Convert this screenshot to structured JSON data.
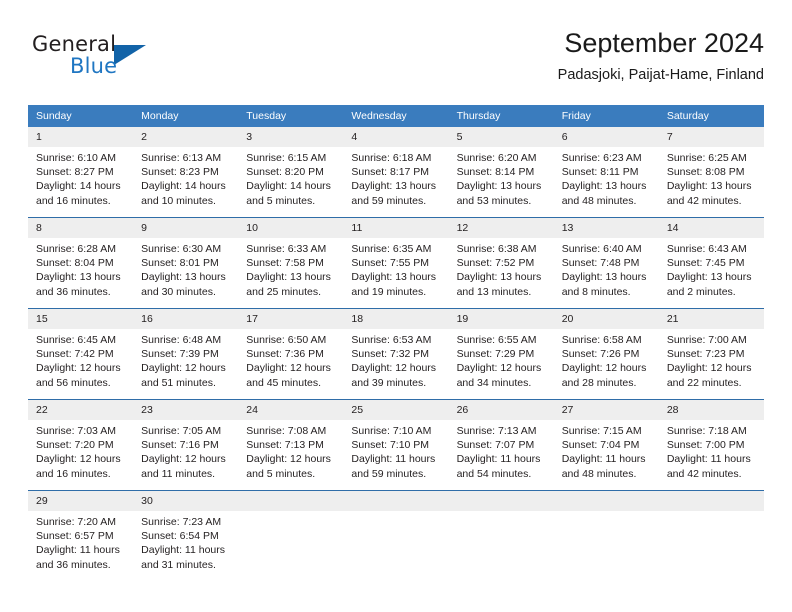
{
  "logo": {
    "word1": "General",
    "word2": "Blue",
    "triangle_color": "#1263a8",
    "text_color": "#231f20",
    "blue_color": "#1f76c2"
  },
  "header": {
    "title": "September 2024",
    "subtitle": "Padasjoki, Paijat-Hame, Finland"
  },
  "theme": {
    "header_bg": "#3a7cbe",
    "header_text": "#ffffff",
    "daynum_bg": "#eeeeee",
    "grid_line": "#2f6da8",
    "body_text": "#231f20"
  },
  "weekday_headers": [
    "Sunday",
    "Monday",
    "Tuesday",
    "Wednesday",
    "Thursday",
    "Friday",
    "Saturday"
  ],
  "weeks": [
    [
      {
        "day": "1",
        "sunrise": "Sunrise: 6:10 AM",
        "sunset": "Sunset: 8:27 PM",
        "daylight_line1": "Daylight: 14 hours",
        "daylight_line2": "and 16 minutes."
      },
      {
        "day": "2",
        "sunrise": "Sunrise: 6:13 AM",
        "sunset": "Sunset: 8:23 PM",
        "daylight_line1": "Daylight: 14 hours",
        "daylight_line2": "and 10 minutes."
      },
      {
        "day": "3",
        "sunrise": "Sunrise: 6:15 AM",
        "sunset": "Sunset: 8:20 PM",
        "daylight_line1": "Daylight: 14 hours",
        "daylight_line2": "and 5 minutes."
      },
      {
        "day": "4",
        "sunrise": "Sunrise: 6:18 AM",
        "sunset": "Sunset: 8:17 PM",
        "daylight_line1": "Daylight: 13 hours",
        "daylight_line2": "and 59 minutes."
      },
      {
        "day": "5",
        "sunrise": "Sunrise: 6:20 AM",
        "sunset": "Sunset: 8:14 PM",
        "daylight_line1": "Daylight: 13 hours",
        "daylight_line2": "and 53 minutes."
      },
      {
        "day": "6",
        "sunrise": "Sunrise: 6:23 AM",
        "sunset": "Sunset: 8:11 PM",
        "daylight_line1": "Daylight: 13 hours",
        "daylight_line2": "and 48 minutes."
      },
      {
        "day": "7",
        "sunrise": "Sunrise: 6:25 AM",
        "sunset": "Sunset: 8:08 PM",
        "daylight_line1": "Daylight: 13 hours",
        "daylight_line2": "and 42 minutes."
      }
    ],
    [
      {
        "day": "8",
        "sunrise": "Sunrise: 6:28 AM",
        "sunset": "Sunset: 8:04 PM",
        "daylight_line1": "Daylight: 13 hours",
        "daylight_line2": "and 36 minutes."
      },
      {
        "day": "9",
        "sunrise": "Sunrise: 6:30 AM",
        "sunset": "Sunset: 8:01 PM",
        "daylight_line1": "Daylight: 13 hours",
        "daylight_line2": "and 30 minutes."
      },
      {
        "day": "10",
        "sunrise": "Sunrise: 6:33 AM",
        "sunset": "Sunset: 7:58 PM",
        "daylight_line1": "Daylight: 13 hours",
        "daylight_line2": "and 25 minutes."
      },
      {
        "day": "11",
        "sunrise": "Sunrise: 6:35 AM",
        "sunset": "Sunset: 7:55 PM",
        "daylight_line1": "Daylight: 13 hours",
        "daylight_line2": "and 19 minutes."
      },
      {
        "day": "12",
        "sunrise": "Sunrise: 6:38 AM",
        "sunset": "Sunset: 7:52 PM",
        "daylight_line1": "Daylight: 13 hours",
        "daylight_line2": "and 13 minutes."
      },
      {
        "day": "13",
        "sunrise": "Sunrise: 6:40 AM",
        "sunset": "Sunset: 7:48 PM",
        "daylight_line1": "Daylight: 13 hours",
        "daylight_line2": "and 8 minutes."
      },
      {
        "day": "14",
        "sunrise": "Sunrise: 6:43 AM",
        "sunset": "Sunset: 7:45 PM",
        "daylight_line1": "Daylight: 13 hours",
        "daylight_line2": "and 2 minutes."
      }
    ],
    [
      {
        "day": "15",
        "sunrise": "Sunrise: 6:45 AM",
        "sunset": "Sunset: 7:42 PM",
        "daylight_line1": "Daylight: 12 hours",
        "daylight_line2": "and 56 minutes."
      },
      {
        "day": "16",
        "sunrise": "Sunrise: 6:48 AM",
        "sunset": "Sunset: 7:39 PM",
        "daylight_line1": "Daylight: 12 hours",
        "daylight_line2": "and 51 minutes."
      },
      {
        "day": "17",
        "sunrise": "Sunrise: 6:50 AM",
        "sunset": "Sunset: 7:36 PM",
        "daylight_line1": "Daylight: 12 hours",
        "daylight_line2": "and 45 minutes."
      },
      {
        "day": "18",
        "sunrise": "Sunrise: 6:53 AM",
        "sunset": "Sunset: 7:32 PM",
        "daylight_line1": "Daylight: 12 hours",
        "daylight_line2": "and 39 minutes."
      },
      {
        "day": "19",
        "sunrise": "Sunrise: 6:55 AM",
        "sunset": "Sunset: 7:29 PM",
        "daylight_line1": "Daylight: 12 hours",
        "daylight_line2": "and 34 minutes."
      },
      {
        "day": "20",
        "sunrise": "Sunrise: 6:58 AM",
        "sunset": "Sunset: 7:26 PM",
        "daylight_line1": "Daylight: 12 hours",
        "daylight_line2": "and 28 minutes."
      },
      {
        "day": "21",
        "sunrise": "Sunrise: 7:00 AM",
        "sunset": "Sunset: 7:23 PM",
        "daylight_line1": "Daylight: 12 hours",
        "daylight_line2": "and 22 minutes."
      }
    ],
    [
      {
        "day": "22",
        "sunrise": "Sunrise: 7:03 AM",
        "sunset": "Sunset: 7:20 PM",
        "daylight_line1": "Daylight: 12 hours",
        "daylight_line2": "and 16 minutes."
      },
      {
        "day": "23",
        "sunrise": "Sunrise: 7:05 AM",
        "sunset": "Sunset: 7:16 PM",
        "daylight_line1": "Daylight: 12 hours",
        "daylight_line2": "and 11 minutes."
      },
      {
        "day": "24",
        "sunrise": "Sunrise: 7:08 AM",
        "sunset": "Sunset: 7:13 PM",
        "daylight_line1": "Daylight: 12 hours",
        "daylight_line2": "and 5 minutes."
      },
      {
        "day": "25",
        "sunrise": "Sunrise: 7:10 AM",
        "sunset": "Sunset: 7:10 PM",
        "daylight_line1": "Daylight: 11 hours",
        "daylight_line2": "and 59 minutes."
      },
      {
        "day": "26",
        "sunrise": "Sunrise: 7:13 AM",
        "sunset": "Sunset: 7:07 PM",
        "daylight_line1": "Daylight: 11 hours",
        "daylight_line2": "and 54 minutes."
      },
      {
        "day": "27",
        "sunrise": "Sunrise: 7:15 AM",
        "sunset": "Sunset: 7:04 PM",
        "daylight_line1": "Daylight: 11 hours",
        "daylight_line2": "and 48 minutes."
      },
      {
        "day": "28",
        "sunrise": "Sunrise: 7:18 AM",
        "sunset": "Sunset: 7:00 PM",
        "daylight_line1": "Daylight: 11 hours",
        "daylight_line2": "and 42 minutes."
      }
    ],
    [
      {
        "day": "29",
        "sunrise": "Sunrise: 7:20 AM",
        "sunset": "Sunset: 6:57 PM",
        "daylight_line1": "Daylight: 11 hours",
        "daylight_line2": "and 36 minutes."
      },
      {
        "day": "30",
        "sunrise": "Sunrise: 7:23 AM",
        "sunset": "Sunset: 6:54 PM",
        "daylight_line1": "Daylight: 11 hours",
        "daylight_line2": "and 31 minutes."
      },
      {
        "day": "",
        "sunrise": "",
        "sunset": "",
        "daylight_line1": "",
        "daylight_line2": ""
      },
      {
        "day": "",
        "sunrise": "",
        "sunset": "",
        "daylight_line1": "",
        "daylight_line2": ""
      },
      {
        "day": "",
        "sunrise": "",
        "sunset": "",
        "daylight_line1": "",
        "daylight_line2": ""
      },
      {
        "day": "",
        "sunrise": "",
        "sunset": "",
        "daylight_line1": "",
        "daylight_line2": ""
      },
      {
        "day": "",
        "sunrise": "",
        "sunset": "",
        "daylight_line1": "",
        "daylight_line2": ""
      }
    ]
  ]
}
